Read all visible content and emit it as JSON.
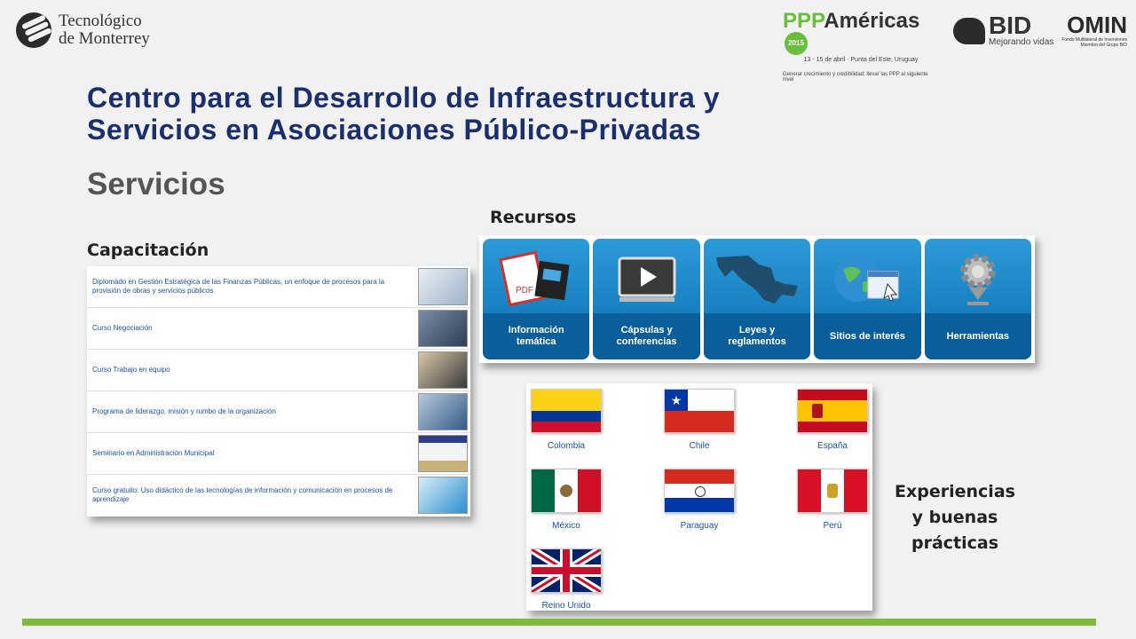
{
  "header": {
    "tec_line1": "Tecnológico",
    "tec_line2": "de Monterrey",
    "ppp_green": "PPP",
    "ppp_dark": "Américas",
    "ppp_year": "2015",
    "ppp_sub": "13 - 15 de abril · Punta del Este, Uruguay",
    "ppp_tag": "Generar crecimiento y credibilidad: llevar las PPP al siguiente nivel",
    "bid_text": "BID",
    "bid_sub": "Mejorando vidas",
    "fomin_text": "OMIN",
    "fomin_sub1": "Fondo Multilateral de Inversiones",
    "fomin_sub2": "Miembro del Grupo BID"
  },
  "title_line1": "Centro para el Desarrollo de Infraestructura y",
  "title_line2": "Servicios en Asociaciones Público-Privadas",
  "section": "Servicios",
  "capacitacion": {
    "label": "Capacitación",
    "items": [
      {
        "text": "Diplomado en Gestión Estratégica de las Finanzas Públicas, un enfoque de procesos para la provisión de obras y servicios públicos"
      },
      {
        "text": "Curso Negociación"
      },
      {
        "text": "Curso Trabajo en equipo"
      },
      {
        "text": "Programa de liderazgo, misión y rumbo de la organización"
      },
      {
        "text": "Seminario en Administración Municipal"
      },
      {
        "text": "Curso gratuito: Uso didáctico de las tecnologías de información y comunicación en procesos de aprendizaje"
      }
    ]
  },
  "recursos": {
    "label": "Recursos",
    "tiles": [
      {
        "line1": "Información",
        "line2": "temática"
      },
      {
        "line1": "Cápsulas y",
        "line2": "conferencias"
      },
      {
        "line1": "Leyes y",
        "line2": "reglamentos"
      },
      {
        "line1": "Sitios de interés",
        "line2": ""
      },
      {
        "line1": "Herramientas",
        "line2": ""
      }
    ]
  },
  "experiencias": {
    "label_line1": "Experiencias",
    "label_line2": "y buenas",
    "label_line3": "prácticas",
    "countries": [
      "Colombia",
      "Chile",
      "España",
      "México",
      "Paraguay",
      "Perú",
      "Reino Unido"
    ]
  },
  "colors": {
    "title": "#1a2f6b",
    "accent_green": "#7cbb3e",
    "link_blue": "#1d4fa8",
    "tile_blue": "#0b6fb0"
  }
}
